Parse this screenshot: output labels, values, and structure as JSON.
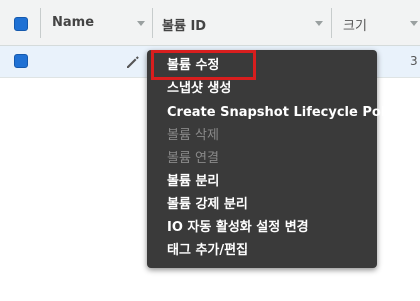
{
  "table": {
    "columns": [
      {
        "label": "Name"
      },
      {
        "label": "볼륨 ID"
      },
      {
        "label": "크기"
      }
    ],
    "row_edge_text": "3"
  },
  "context_menu": {
    "items": [
      {
        "label": "볼륨 수정",
        "enabled": true,
        "highlighted": true
      },
      {
        "label": "스냅샷 생성",
        "enabled": true
      },
      {
        "label": "Create Snapshot Lifecycle Policy",
        "enabled": true
      },
      {
        "label": "볼륨 삭제",
        "enabled": false
      },
      {
        "label": "볼륨 연결",
        "enabled": false
      },
      {
        "label": "볼륨 분리",
        "enabled": true
      },
      {
        "label": "볼륨 강제 분리",
        "enabled": true
      },
      {
        "label": "IO 자동 활성화 설정 변경",
        "enabled": true
      },
      {
        "label": "태그 추가/편집",
        "enabled": true
      }
    ]
  },
  "colors": {
    "checkbox": "#1f71d4",
    "menu_background": "#3a3a3a",
    "highlight_border": "#d81e1e",
    "row_selected": "#e9f2fb"
  },
  "icons": {
    "edit": "pencil-icon",
    "sort": "caret-down-icon"
  }
}
